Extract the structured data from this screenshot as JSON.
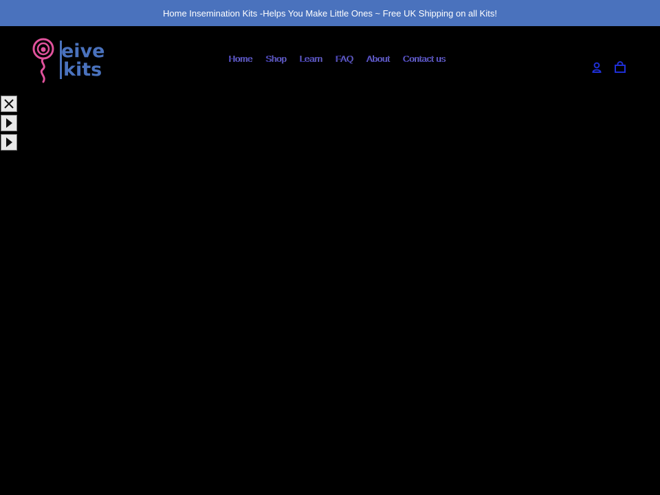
{
  "announcement": {
    "text": "Home Insemination Kits -Helps You Make Little Ones ~ Free UK Shipping on all Kits!"
  },
  "brand": {
    "line1": "eive",
    "line2": "kits",
    "logo_icon": "sperm-logo-icon",
    "colors": {
      "pink": "#e0529c",
      "blue": "#4a72bd"
    }
  },
  "nav": {
    "items": [
      {
        "label": "Home"
      },
      {
        "label": "Shop"
      },
      {
        "label": "Learn"
      },
      {
        "label": "FAQ"
      },
      {
        "label": "About"
      },
      {
        "label": "Contact us"
      }
    ]
  },
  "header_icons": {
    "account": "user-icon",
    "cart": "cart-icon"
  },
  "side_controls": [
    {
      "icon": "close-icon"
    },
    {
      "icon": "play-icon"
    },
    {
      "icon": "play-icon"
    }
  ],
  "colors": {
    "background": "#000000",
    "announcement_bg": "#4a72bd",
    "nav_link": "#2f2a9b",
    "icon_blue": "#1f2fd6"
  }
}
